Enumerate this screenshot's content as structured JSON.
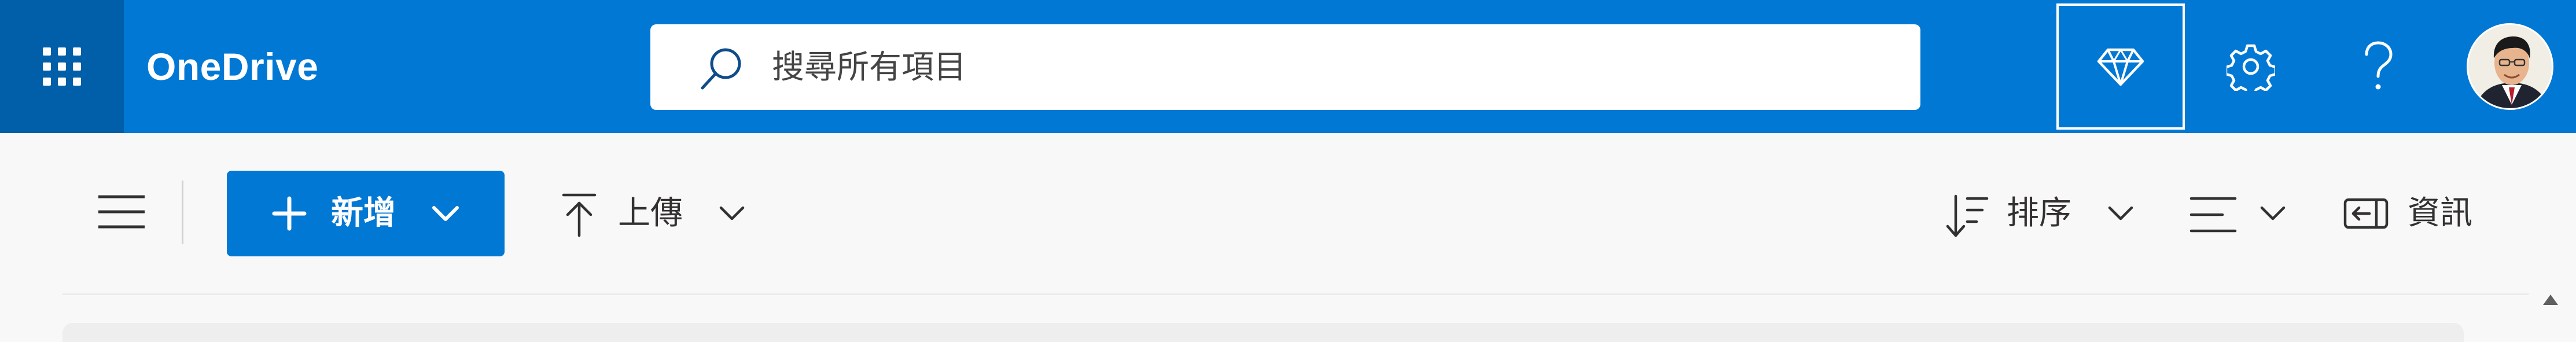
{
  "app": {
    "title": "OneDrive"
  },
  "header": {
    "search": {
      "placeholder": "搜尋所有項目",
      "value": ""
    },
    "icons": {
      "app_launcher": "waffle-icon",
      "premium": "diamond-icon",
      "settings": "gear-icon",
      "help": "question-icon",
      "profile": "avatar"
    }
  },
  "commandbar": {
    "new_label": "新增",
    "upload_label": "上傳",
    "sort_label": "排序",
    "info_label": "資訊"
  },
  "colors": {
    "brand": "#0078d4",
    "brand_dark": "#005fa8",
    "background": "#f8f8f8",
    "text": "#323130"
  }
}
